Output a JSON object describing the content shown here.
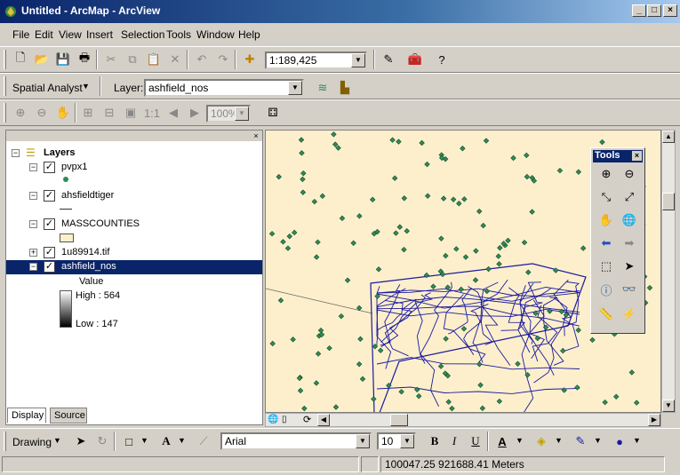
{
  "window": {
    "title": "Untitled - ArcMap - ArcView"
  },
  "menu": [
    "File",
    "Edit",
    "View",
    "Insert",
    "Selection",
    "Tools",
    "Window",
    "Help"
  ],
  "standard_toolbar": {
    "scale": "1:189,425"
  },
  "spatial_analyst": {
    "label": "Spatial Analyst",
    "layer_label": "Layer:",
    "layer_value": "ashfield_nos"
  },
  "tools_toolbar": {
    "zoom": "100%"
  },
  "toc": {
    "root": "Layers",
    "layers": [
      "pvpx1",
      "ahsfieldtiger",
      "MASSCOUNTIES",
      "1u89914.tif",
      "ashfield_nos"
    ],
    "legend": {
      "value": "Value",
      "high": "High : 564",
      "low": "Low : 147"
    },
    "tabs": [
      "Display",
      "Source"
    ]
  },
  "tools_window": {
    "title": "Tools"
  },
  "drawing": {
    "label": "Drawing",
    "font": "Arial",
    "size": "10"
  },
  "status": {
    "coords": "100047.25  921688.41 Meters"
  },
  "colors": {
    "map_background": "#fdefcc",
    "points": "#2e8b57",
    "roads": "#1a1aa0",
    "selection": "#0a246a"
  }
}
